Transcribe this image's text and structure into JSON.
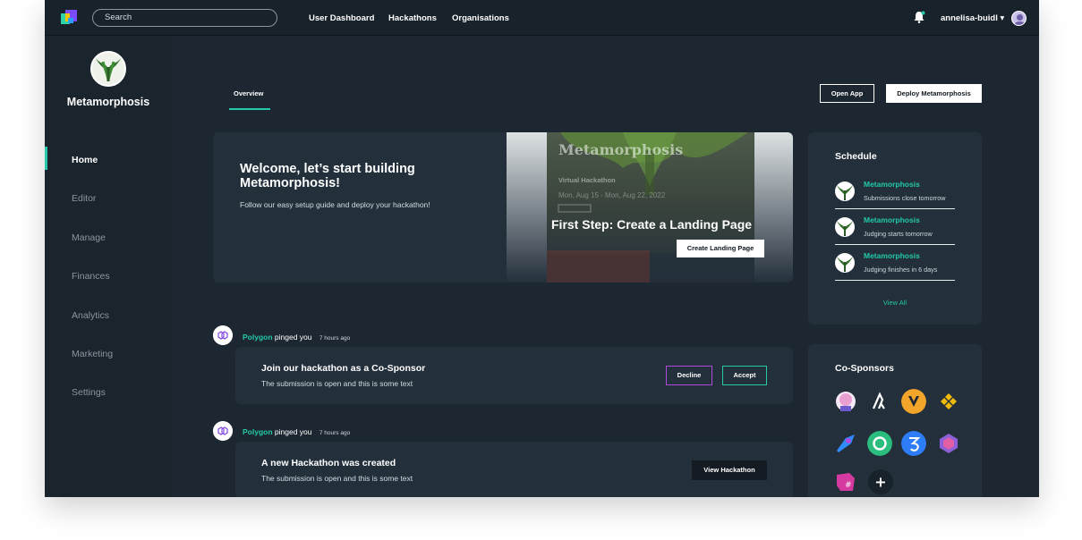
{
  "topbar": {
    "search_placeholder": "Search",
    "nav": [
      "User Dashboard",
      "Hackathons",
      "Organisations"
    ],
    "username": "annelisa-buidl",
    "username_caret": "▾"
  },
  "sidebar": {
    "title": "Metamorphosis",
    "items": [
      "Home",
      "Editor",
      "Manage",
      "Finances",
      "Analytics",
      "Marketing",
      "Settings"
    ],
    "active": "Home"
  },
  "main": {
    "tab": "Overview",
    "open_app": "Open App",
    "deploy": "Deploy Metamorphosis",
    "welcome_title": "Welcome, let’s start building Metamorphosis!",
    "welcome_sub": "Follow our easy setup guide and deploy your hackathon!",
    "landing": {
      "preview_title": "Metamorphosis",
      "preview_subtitle": "Virtual Hackathon",
      "preview_date": "Mon, Aug 15 - Mon, Aug 22, 2022",
      "step": "First Step: Create a Landing Page",
      "button": "Create Landing Page"
    }
  },
  "schedule": {
    "title": "Schedule",
    "items": [
      {
        "name": "Metamorphosis",
        "desc": "Submissions close tomorrow"
      },
      {
        "name": "Metamorphosis",
        "desc": "Judging starts tomorrow"
      },
      {
        "name": "Metamorphosis",
        "desc": "Judging finishes in 6 days"
      }
    ],
    "view_all": "View All"
  },
  "cosponsors": {
    "title": "Co-Sponsors",
    "add_symbol": "+"
  },
  "pings": [
    {
      "from": "Polygon",
      "action": "pinged you",
      "time": "7 hours ago",
      "title": "Join our hackathon as a Co-Sponsor",
      "sub": "The submission is open and this is some text",
      "decline": "Decline",
      "accept": "Accept"
    },
    {
      "from": "Polygon",
      "action": "pinged you",
      "time": "7 hours ago",
      "title": "A new Hackathon was created",
      "sub": "The submission is open and this is some text",
      "view": "View Hackathon"
    }
  ],
  "colors": {
    "accent": "#23c9a8",
    "background": "#1d2731",
    "card": "#232f3b",
    "decline": "#b04adf"
  }
}
